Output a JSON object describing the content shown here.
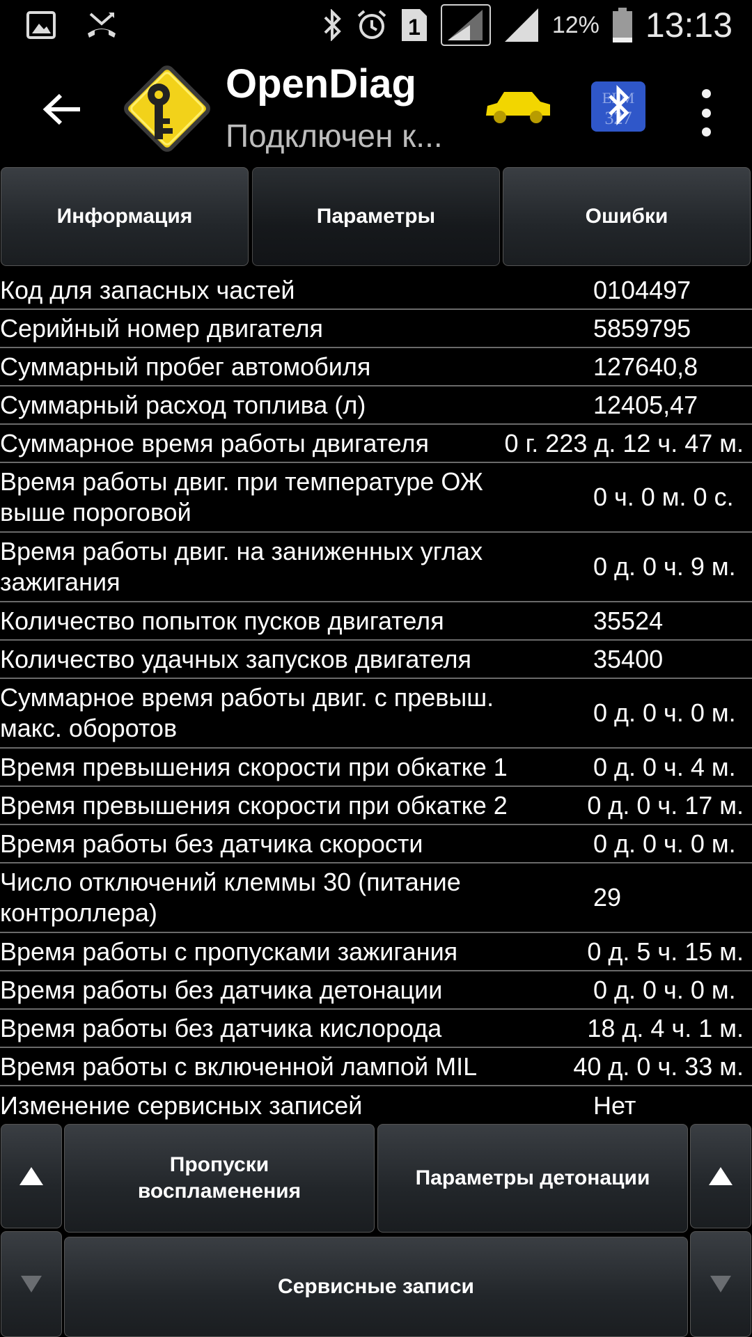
{
  "status_bar": {
    "icons_left": [
      "gallery-icon",
      "missed-call-icon"
    ],
    "icons_right": [
      "bluetooth-icon",
      "alarm-icon",
      "sim1-icon",
      "signal-icon",
      "signal-icon"
    ],
    "sim_label": "1",
    "battery_percent": "12%",
    "time": "13:13"
  },
  "app_bar": {
    "title": "OpenDiag",
    "subtitle": "Подключен к...",
    "logo_color": "#f2d21a",
    "car_color": "#f2d600",
    "bt_badge_color": "#2f57c9"
  },
  "tabs": [
    {
      "label": "Информация",
      "active": false
    },
    {
      "label": "Параметры",
      "active": true
    },
    {
      "label": "Ошибки",
      "active": false
    }
  ],
  "params": [
    {
      "label": "Код для запасных частей",
      "value": "0104497"
    },
    {
      "label": "Серийный номер двигателя",
      "value": "5859795"
    },
    {
      "label": "Суммарный пробег автомобиля",
      "value": "127640,8"
    },
    {
      "label": "Суммарный расход топлива (л)",
      "value": "12405,47"
    },
    {
      "label": "Суммарное время работы двигателя",
      "value": "0 г. 223 д. 12 ч. 47 м."
    },
    {
      "label": "Время работы двиг. при температуре ОЖ\nвыше пороговой",
      "value": "0 ч. 0 м. 0 с."
    },
    {
      "label": "Время работы двиг. на заниженных углах\nзажигания",
      "value": "0 д. 0 ч. 9 м."
    },
    {
      "label": "Количество попыток пусков двигателя",
      "value": "35524"
    },
    {
      "label": "Количество удачных запусков двигателя",
      "value": "35400"
    },
    {
      "label": "Суммарное время работы двиг. с превыш.\nмакс. оборотов",
      "value": "0 д. 0 ч. 0 м."
    },
    {
      "label": "Время превышения скорости при обкатке 1",
      "value": "0 д. 0 ч. 4 м."
    },
    {
      "label": "Время превышения скорости при обкатке 2",
      "value": "0 д. 0 ч. 17 м."
    },
    {
      "label": "Время работы без датчика скорости",
      "value": "0 д. 0 ч. 0 м."
    },
    {
      "label": "Число отключений клеммы 30 (питание\nконтроллера)",
      "value": "29"
    },
    {
      "label": "Время работы с пропусками зажигания",
      "value": "0 д. 5 ч. 15 м."
    },
    {
      "label": "Время работы без датчика детонации",
      "value": "0 д. 0 ч. 0 м."
    },
    {
      "label": "Время работы без датчика кислорода",
      "value": "18 д. 4 ч. 1 м."
    },
    {
      "label": "Время работы с включенной лампой MIL",
      "value": "40 д. 0 ч. 33 м."
    },
    {
      "label": "Изменение сервисных записей",
      "value": "Нет"
    }
  ],
  "bottom": {
    "misfire_label": "Пропуски\nвоспламенения",
    "detonation_label": "Параметры детонации",
    "service_label": "Сервисные записи"
  }
}
